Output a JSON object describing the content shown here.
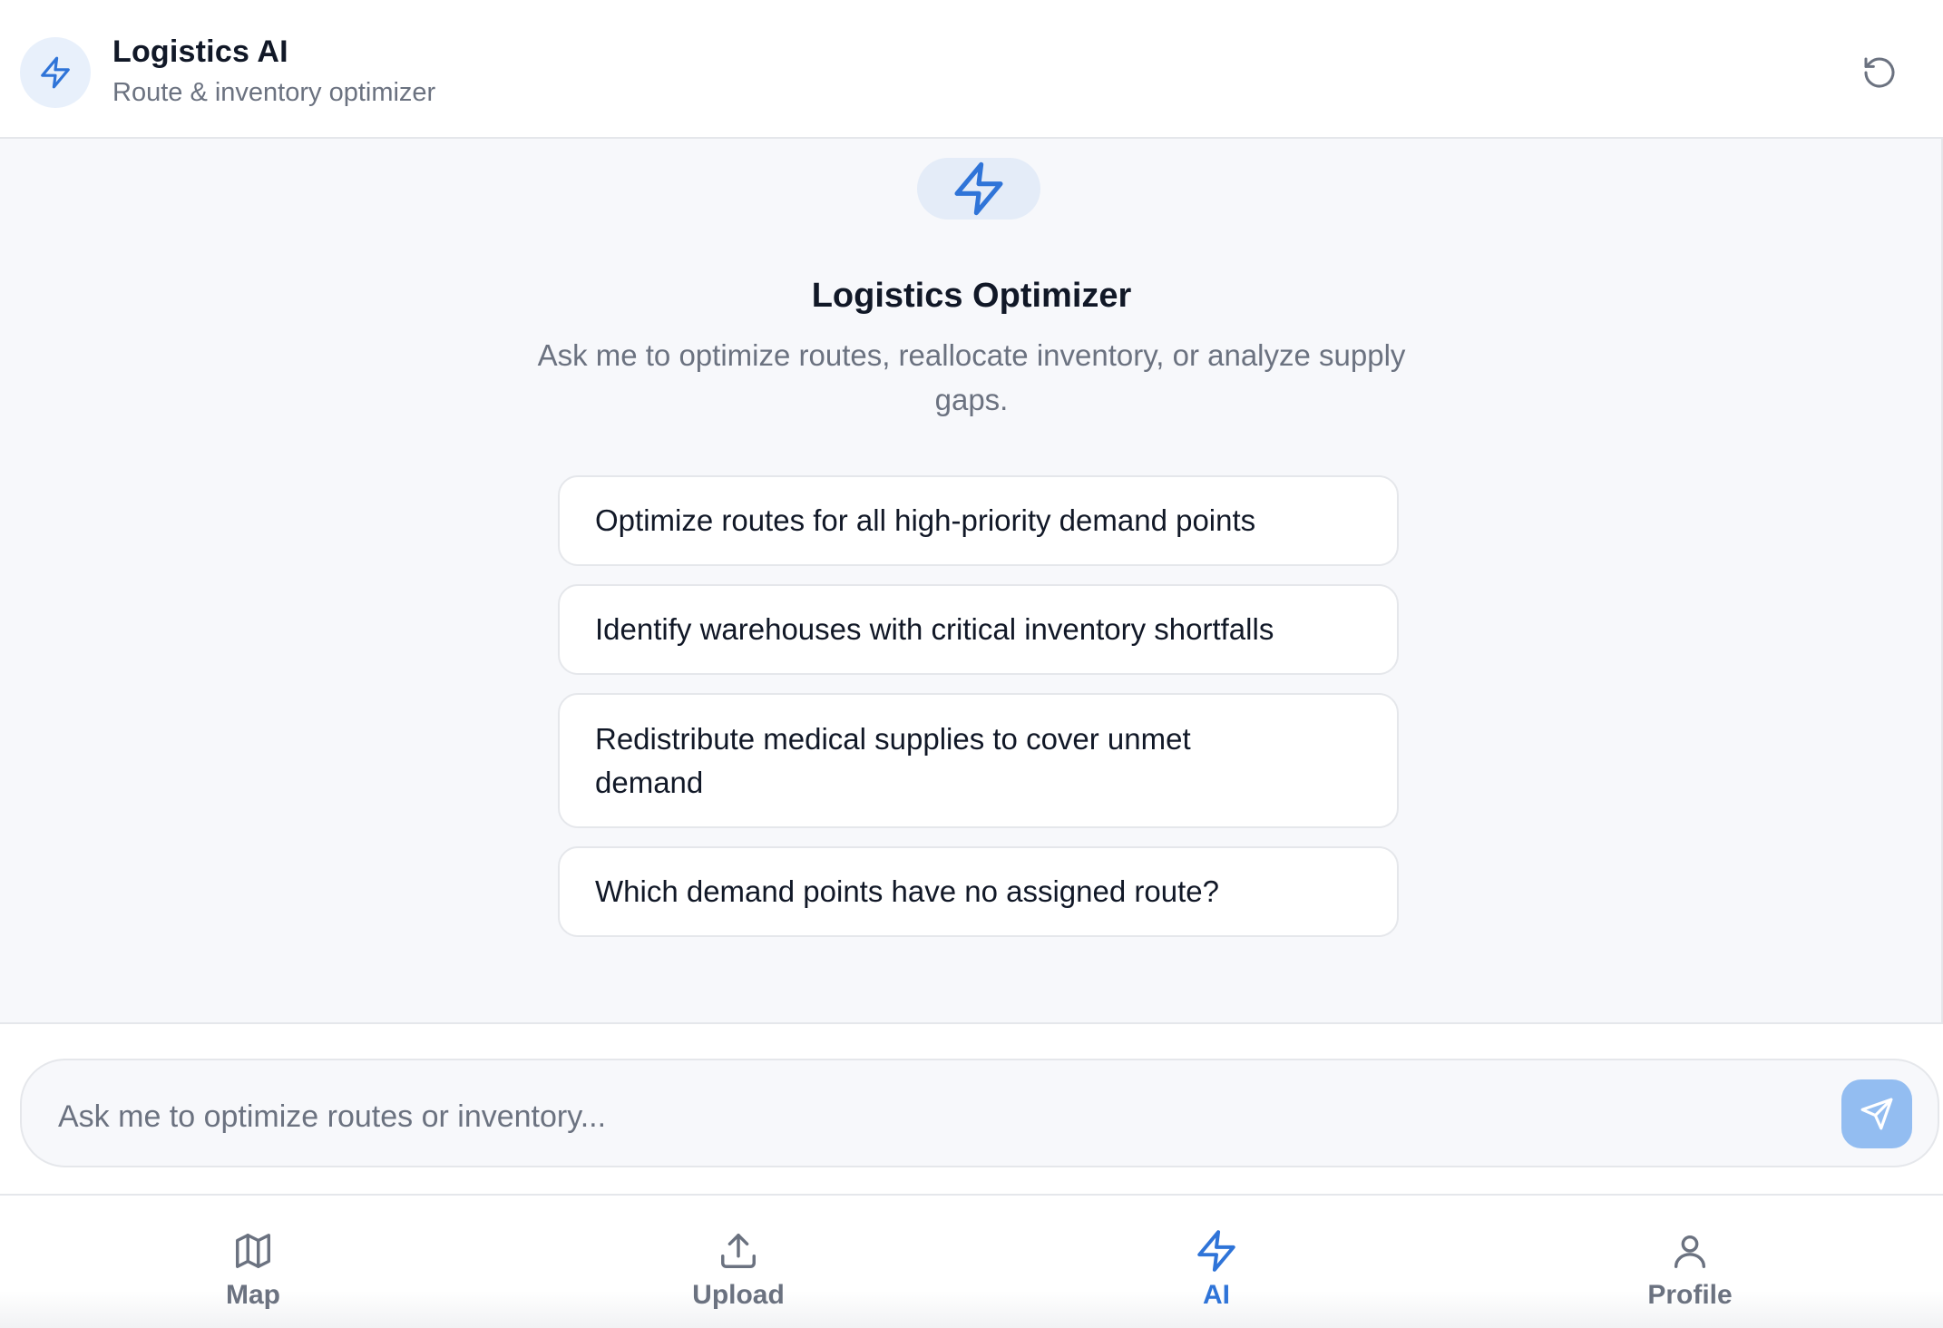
{
  "header": {
    "title": "Logistics AI",
    "subtitle": "Route & inventory optimizer",
    "logo_icon": "lightning-icon",
    "reset_icon": "refresh-icon"
  },
  "main": {
    "hero_icon": "lightning-icon",
    "title": "Logistics Optimizer",
    "description": "Ask me to optimize routes, reallocate inventory, or analyze supply gaps.",
    "suggestions": [
      "Optimize routes for all high-priority demand points",
      "Identify warehouses with critical inventory shortfalls",
      "Redistribute medical supplies to cover unmet demand",
      "Which demand points have no assigned route?"
    ]
  },
  "input": {
    "placeholder": "Ask me to optimize routes or inventory...",
    "value": "",
    "send_icon": "send-icon"
  },
  "nav": {
    "items": [
      {
        "label": "Map",
        "icon": "map-icon",
        "active": false
      },
      {
        "label": "Upload",
        "icon": "upload-icon",
        "active": false
      },
      {
        "label": "AI",
        "icon": "lightning-icon",
        "active": true
      },
      {
        "label": "Profile",
        "icon": "user-icon",
        "active": false
      }
    ]
  },
  "colors": {
    "accent": "#2f74d8",
    "accent_soft": "#e4ecf8",
    "send_button": "#93bdf1",
    "muted_text": "#6b7280",
    "background": "#f7f8fb",
    "border": "#e5e7eb"
  }
}
